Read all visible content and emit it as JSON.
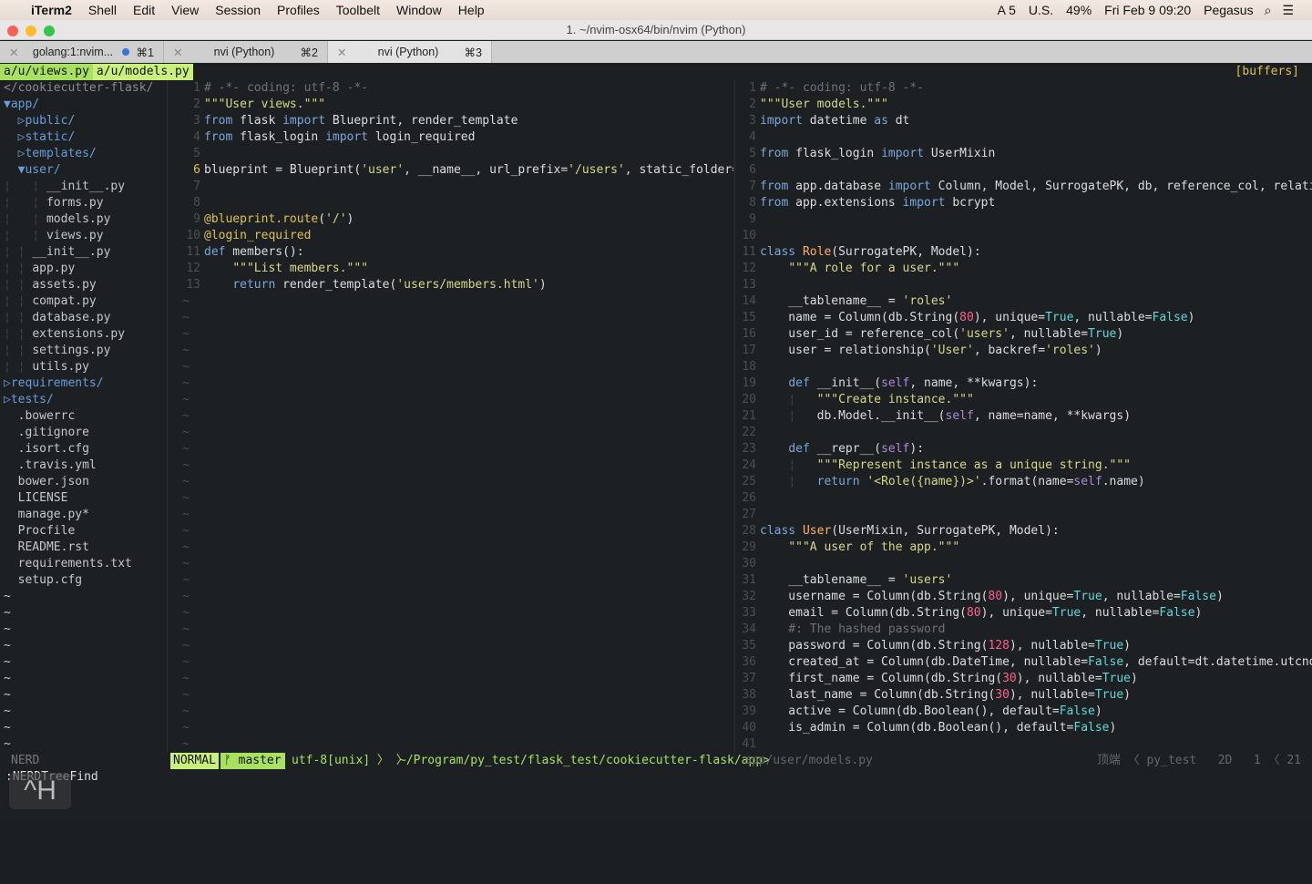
{
  "menubar": {
    "items": [
      "iTerm2",
      "Shell",
      "Edit",
      "View",
      "Session",
      "Profiles",
      "Toolbelt",
      "Window",
      "Help"
    ],
    "status": [
      "A 5",
      "U.S.",
      "49%",
      "Fri Feb 9  09:20",
      "Pegasus"
    ]
  },
  "window": {
    "title": "1. ~/nvim-osx64/bin/nvim (Python)"
  },
  "tabs": [
    {
      "label": "golang:1:nvim...",
      "shortcut": "⌘1",
      "active": false,
      "activity": true
    },
    {
      "label": "nvi (Python)",
      "shortcut": "⌘2",
      "active": false
    },
    {
      "label": "nvi (Python)",
      "shortcut": "⌘3",
      "active": true
    }
  ],
  "buffers": {
    "items": [
      "a/u/views.py",
      "a/u/models.py"
    ],
    "right": "[buffers]"
  },
  "tree": [
    {
      "t": "</cookiecutter-flask/",
      "k": "root"
    },
    {
      "t": "▼app/",
      "k": "dir",
      "i": 0
    },
    {
      "t": "▷public/",
      "k": "dir",
      "i": 1
    },
    {
      "t": "▷static/",
      "k": "dir",
      "i": 1
    },
    {
      "t": "▷templates/",
      "k": "dir",
      "i": 1
    },
    {
      "t": "▼user/",
      "k": "dir",
      "i": 1
    },
    {
      "t": "__init__.py",
      "k": "f",
      "i": 3
    },
    {
      "t": "forms.py",
      "k": "f",
      "i": 3
    },
    {
      "t": "models.py",
      "k": "f",
      "i": 3
    },
    {
      "t": "views.py",
      "k": "f",
      "i": 3
    },
    {
      "t": "__init__.py",
      "k": "f",
      "i": 2
    },
    {
      "t": "app.py",
      "k": "f",
      "i": 2
    },
    {
      "t": "assets.py",
      "k": "f",
      "i": 2
    },
    {
      "t": "compat.py",
      "k": "f",
      "i": 2
    },
    {
      "t": "database.py",
      "k": "f",
      "i": 2
    },
    {
      "t": "extensions.py",
      "k": "f",
      "i": 2
    },
    {
      "t": "settings.py",
      "k": "f",
      "i": 2
    },
    {
      "t": "utils.py",
      "k": "f",
      "i": 2
    },
    {
      "t": "▷requirements/",
      "k": "dir",
      "i": 0
    },
    {
      "t": "▷tests/",
      "k": "dir",
      "i": 0
    },
    {
      "t": ".bowerrc",
      "k": "f",
      "i": 1
    },
    {
      "t": ".gitignore",
      "k": "f",
      "i": 1
    },
    {
      "t": ".isort.cfg",
      "k": "f",
      "i": 1
    },
    {
      "t": ".travis.yml",
      "k": "f",
      "i": 1
    },
    {
      "t": "bower.json",
      "k": "f",
      "i": 1
    },
    {
      "t": "LICENSE",
      "k": "f",
      "i": 1
    },
    {
      "t": "manage.py*",
      "k": "f",
      "i": 1
    },
    {
      "t": "Procfile",
      "k": "f",
      "i": 1
    },
    {
      "t": "README.rst",
      "k": "f",
      "i": 1
    },
    {
      "t": "requirements.txt",
      "k": "f",
      "i": 1
    },
    {
      "t": "setup.cfg",
      "k": "f",
      "i": 1
    }
  ],
  "left_code": [
    "# -*- coding: utf-8 -*-",
    "\"\"\"User views.\"\"\"",
    "from flask import Blueprint, render_template",
    "from flask_login import login_required",
    "",
    "blueprint = Blueprint('user', __name__, url_prefix='/users', static_folder='../s",
    "",
    "",
    "@blueprint.route('/')",
    "@login_required",
    "def members():",
    "    \"\"\"List members.\"\"\"",
    "    return render_template('users/members.html')"
  ],
  "right_code": [
    "# -*- coding: utf-8 -*-",
    "\"\"\"User models.\"\"\"",
    "import datetime as dt",
    "",
    "from flask_login import UserMixin",
    "",
    "from app.database import Column, Model, SurrogatePK, db, reference_col, relationship",
    "from app.extensions import bcrypt",
    "",
    "",
    "class Role(SurrogatePK, Model):",
    "    \"\"\"A role for a user.\"\"\"",
    "",
    "    __tablename__ = 'roles'",
    "    name = Column(db.String(80), unique=True, nullable=False)",
    "    user_id = reference_col('users', nullable=True)",
    "    user = relationship('User', backref='roles')",
    "",
    "    def __init__(self, name, **kwargs):",
    "    ¦   \"\"\"Create instance.\"\"\"",
    "    ¦   db.Model.__init__(self, name=name, **kwargs)",
    "",
    "    def __repr__(self):",
    "    ¦   \"\"\"Represent instance as a unique string.\"\"\"",
    "    ¦   return '<Role({name})>'.format(name=self.name)",
    "",
    "",
    "class User(UserMixin, SurrogatePK, Model):",
    "    \"\"\"A user of the app.\"\"\"",
    "",
    "    __tablename__ = 'users'",
    "    username = Column(db.String(80), unique=True, nullable=False)",
    "    email = Column(db.String(80), unique=True, nullable=False)",
    "    #: The hashed password",
    "    password = Column(db.String(128), nullable=True)",
    "    created_at = Column(db.DateTime, nullable=False, default=dt.datetime.utcnow)",
    "    first_name = Column(db.String(30), nullable=True)",
    "    last_name = Column(db.String(30), nullable=True)",
    "    active = Column(db.Boolean(), default=False)",
    "    is_admin = Column(db.Boolean(), default=False)",
    ""
  ],
  "status": {
    "tree": "NERD",
    "mode": "NORMAL",
    "branch": "ᚠ master",
    "encoding": "utf-8[unix] 〉 〉",
    "path": "~/Program/py_test/flask_test/cookiecutter-flask/app>",
    "file": "app/user/models.py",
    "pos": "顶端 〈 py_test   2D   1 〈 21"
  },
  "command": ":NERDTreeFind",
  "hint": "^H",
  "colors": {
    "mode_bg": "#c9f07c",
    "background": "#1d2023"
  }
}
